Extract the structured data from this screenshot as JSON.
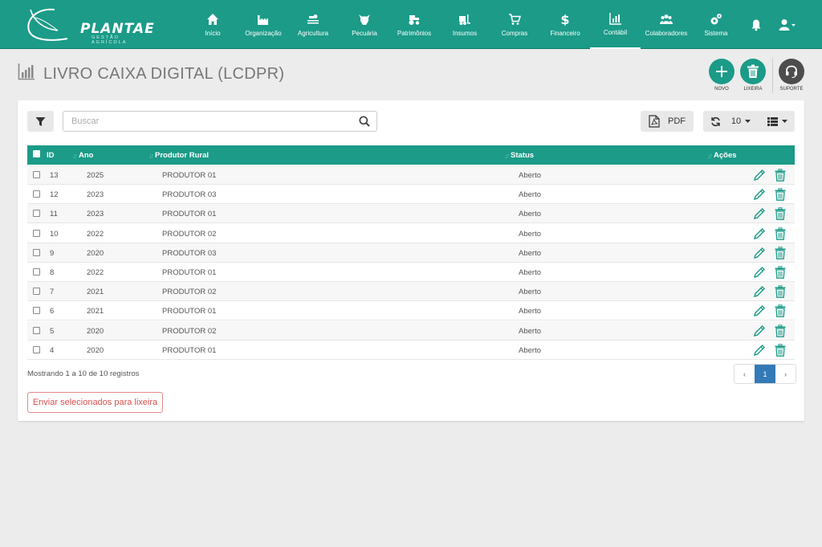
{
  "brand": {
    "name": "PLANTAE",
    "tagline": "GESTÃO AGRÍCOLA"
  },
  "nav": [
    {
      "label": "Início",
      "icon": "home-icon"
    },
    {
      "label": "Organização",
      "icon": "factory-icon"
    },
    {
      "label": "Agricultura",
      "icon": "tractor-field-icon"
    },
    {
      "label": "Pecuária",
      "icon": "cow-icon"
    },
    {
      "label": "Patrimônios",
      "icon": "tractor-icon"
    },
    {
      "label": "Insumos",
      "icon": "forklift-icon"
    },
    {
      "label": "Compras",
      "icon": "cart-icon"
    },
    {
      "label": "Financeiro",
      "icon": "dollar-icon"
    },
    {
      "label": "Contábil",
      "icon": "chart-icon"
    },
    {
      "label": "Colaboradores",
      "icon": "users-icon"
    },
    {
      "label": "Sistema",
      "icon": "gears-icon"
    }
  ],
  "active_nav": "Contábil",
  "page": {
    "title": "LIVRO CAIXA DIGITAL (LCDPR)"
  },
  "actions": {
    "new_label": "NOVO",
    "trash_label": "LIXEIRA",
    "support_label": "SUPORTE"
  },
  "toolbar": {
    "search_placeholder": "Buscar",
    "pdf_label": "PDF",
    "page_size": "10"
  },
  "table": {
    "headers": {
      "id": "ID",
      "year": "Ano",
      "producer": "Produtor Rural",
      "status": "Status",
      "actions": "Ações"
    },
    "rows": [
      {
        "id": "13",
        "year": "2025",
        "producer": "PRODUTOR 01",
        "status": "Aberto"
      },
      {
        "id": "12",
        "year": "2023",
        "producer": "PRODUTOR 03",
        "status": "Aberto"
      },
      {
        "id": "11",
        "year": "2023",
        "producer": "PRODUTOR 01",
        "status": "Aberto"
      },
      {
        "id": "10",
        "year": "2022",
        "producer": "PRODUTOR 02",
        "status": "Aberto"
      },
      {
        "id": "9",
        "year": "2020",
        "producer": "PRODUTOR 03",
        "status": "Aberto"
      },
      {
        "id": "8",
        "year": "2022",
        "producer": "PRODUTOR 01",
        "status": "Aberto"
      },
      {
        "id": "7",
        "year": "2021",
        "producer": "PRODUTOR 02",
        "status": "Aberto"
      },
      {
        "id": "6",
        "year": "2021",
        "producer": "PRODUTOR 01",
        "status": "Aberto"
      },
      {
        "id": "5",
        "year": "2020",
        "producer": "PRODUTOR 02",
        "status": "Aberto"
      },
      {
        "id": "4",
        "year": "2020",
        "producer": "PRODUTOR 01",
        "status": "Aberto"
      }
    ]
  },
  "footer": {
    "info": "Mostrando 1 a 10 de 10 registros",
    "prev": "‹",
    "page": "1",
    "next": "›",
    "trash_selected": "Enviar selecionados para lixeira"
  },
  "colors": {
    "primary": "#1b9b88",
    "pager_active": "#337ab7",
    "danger": "#d9534f"
  }
}
